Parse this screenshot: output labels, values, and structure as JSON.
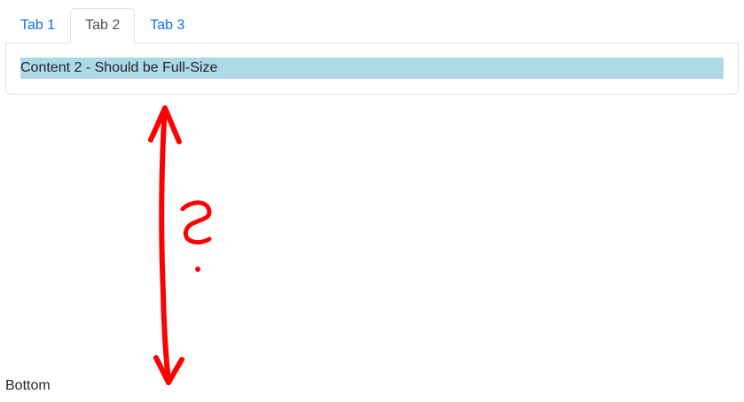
{
  "tabs": [
    {
      "label": "Tab 1",
      "active": false
    },
    {
      "label": "Tab 2",
      "active": true
    },
    {
      "label": "Tab 3",
      "active": false
    }
  ],
  "content": {
    "text": "Content 2 - Should be Full-Size"
  },
  "footer": {
    "text": "Bottom"
  },
  "annotation": {
    "glyph": "?",
    "color": "#ff0000"
  },
  "colors": {
    "link": "#0d6efd",
    "pane_background": "#add8e6",
    "border": "#dee2e6"
  }
}
